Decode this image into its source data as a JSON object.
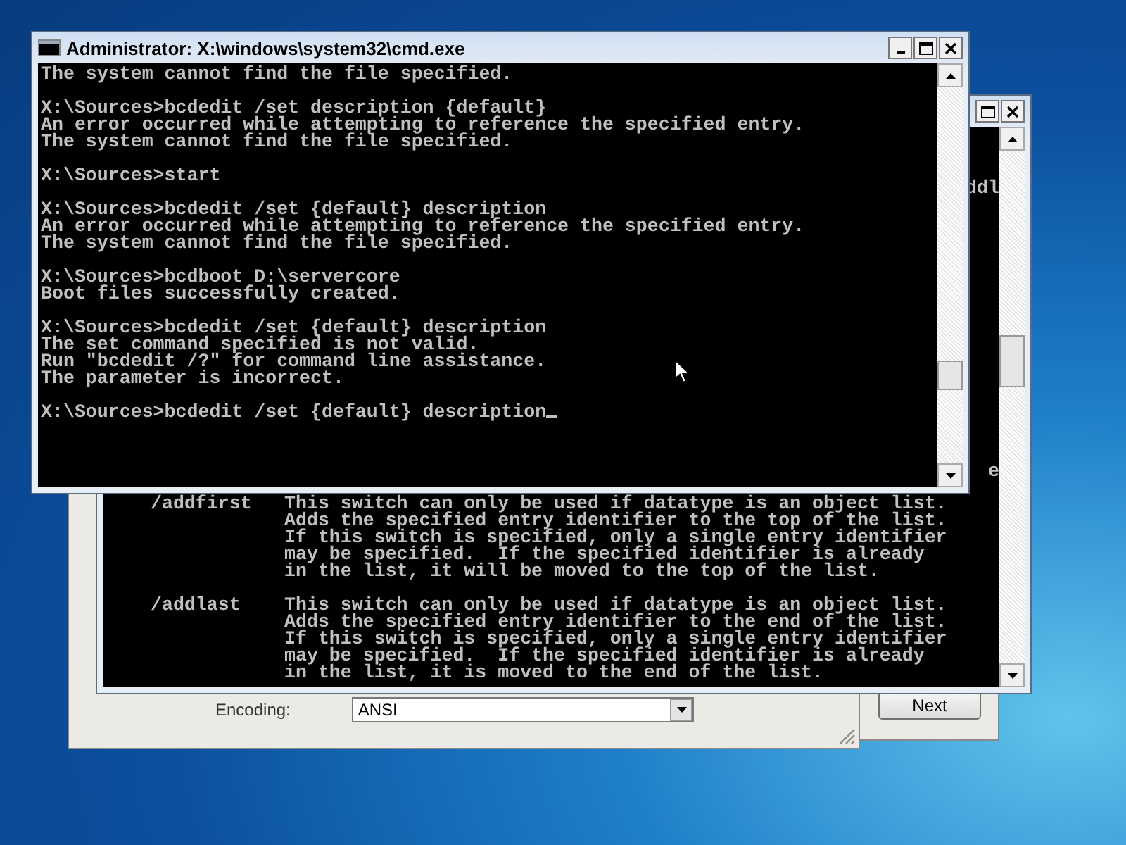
{
  "front_console": {
    "title": "Administrator: X:\\windows\\system32\\cmd.exe",
    "blocks": [
      [
        "The system cannot find the file specified."
      ],
      [
        "X:\\Sources>bcdedit /set description {default}",
        "An error occurred while attempting to reference the specified entry.",
        "The system cannot find the file specified."
      ],
      [
        "X:\\Sources>start"
      ],
      [
        "X:\\Sources>bcdedit /set {default} description",
        "An error occurred while attempting to reference the specified entry.",
        "The system cannot find the file specified."
      ],
      [
        "X:\\Sources>bcdboot D:\\servercore",
        "Boot files successfully created."
      ],
      [
        "X:\\Sources>bcdedit /set {default} description",
        "The set command specified is not valid.",
        "Run \"bcdedit /?\" for command line assistance.",
        "The parameter is incorrect."
      ],
      [
        "X:\\Sources>bcdedit /set {default} description"
      ]
    ]
  },
  "back_console": {
    "fragments": [
      "ddl",
      "e"
    ],
    "help": [
      {
        "switch": "/addfirst",
        "lines": [
          "This switch can only be used if datatype is an object list.",
          "Adds the specified entry identifier to the top of the list.",
          "If this switch is specified, only a single entry identifier",
          "may be specified.  If the specified identifier is already",
          "in the list, it will be moved to the top of the list."
        ]
      },
      {
        "switch": "/addlast",
        "lines": [
          "This switch can only be used if datatype is an object list.",
          "Adds the specified entry identifier to the end of the list.",
          "If this switch is specified, only a single entry identifier",
          "may be specified.  If the specified identifier is already",
          "in the list, it is moved to the end of the list."
        ]
      }
    ]
  },
  "save_dialog": {
    "encoding_label": "Encoding:",
    "encoding_value": "ANSI"
  },
  "wizard": {
    "next_button": "Next"
  }
}
